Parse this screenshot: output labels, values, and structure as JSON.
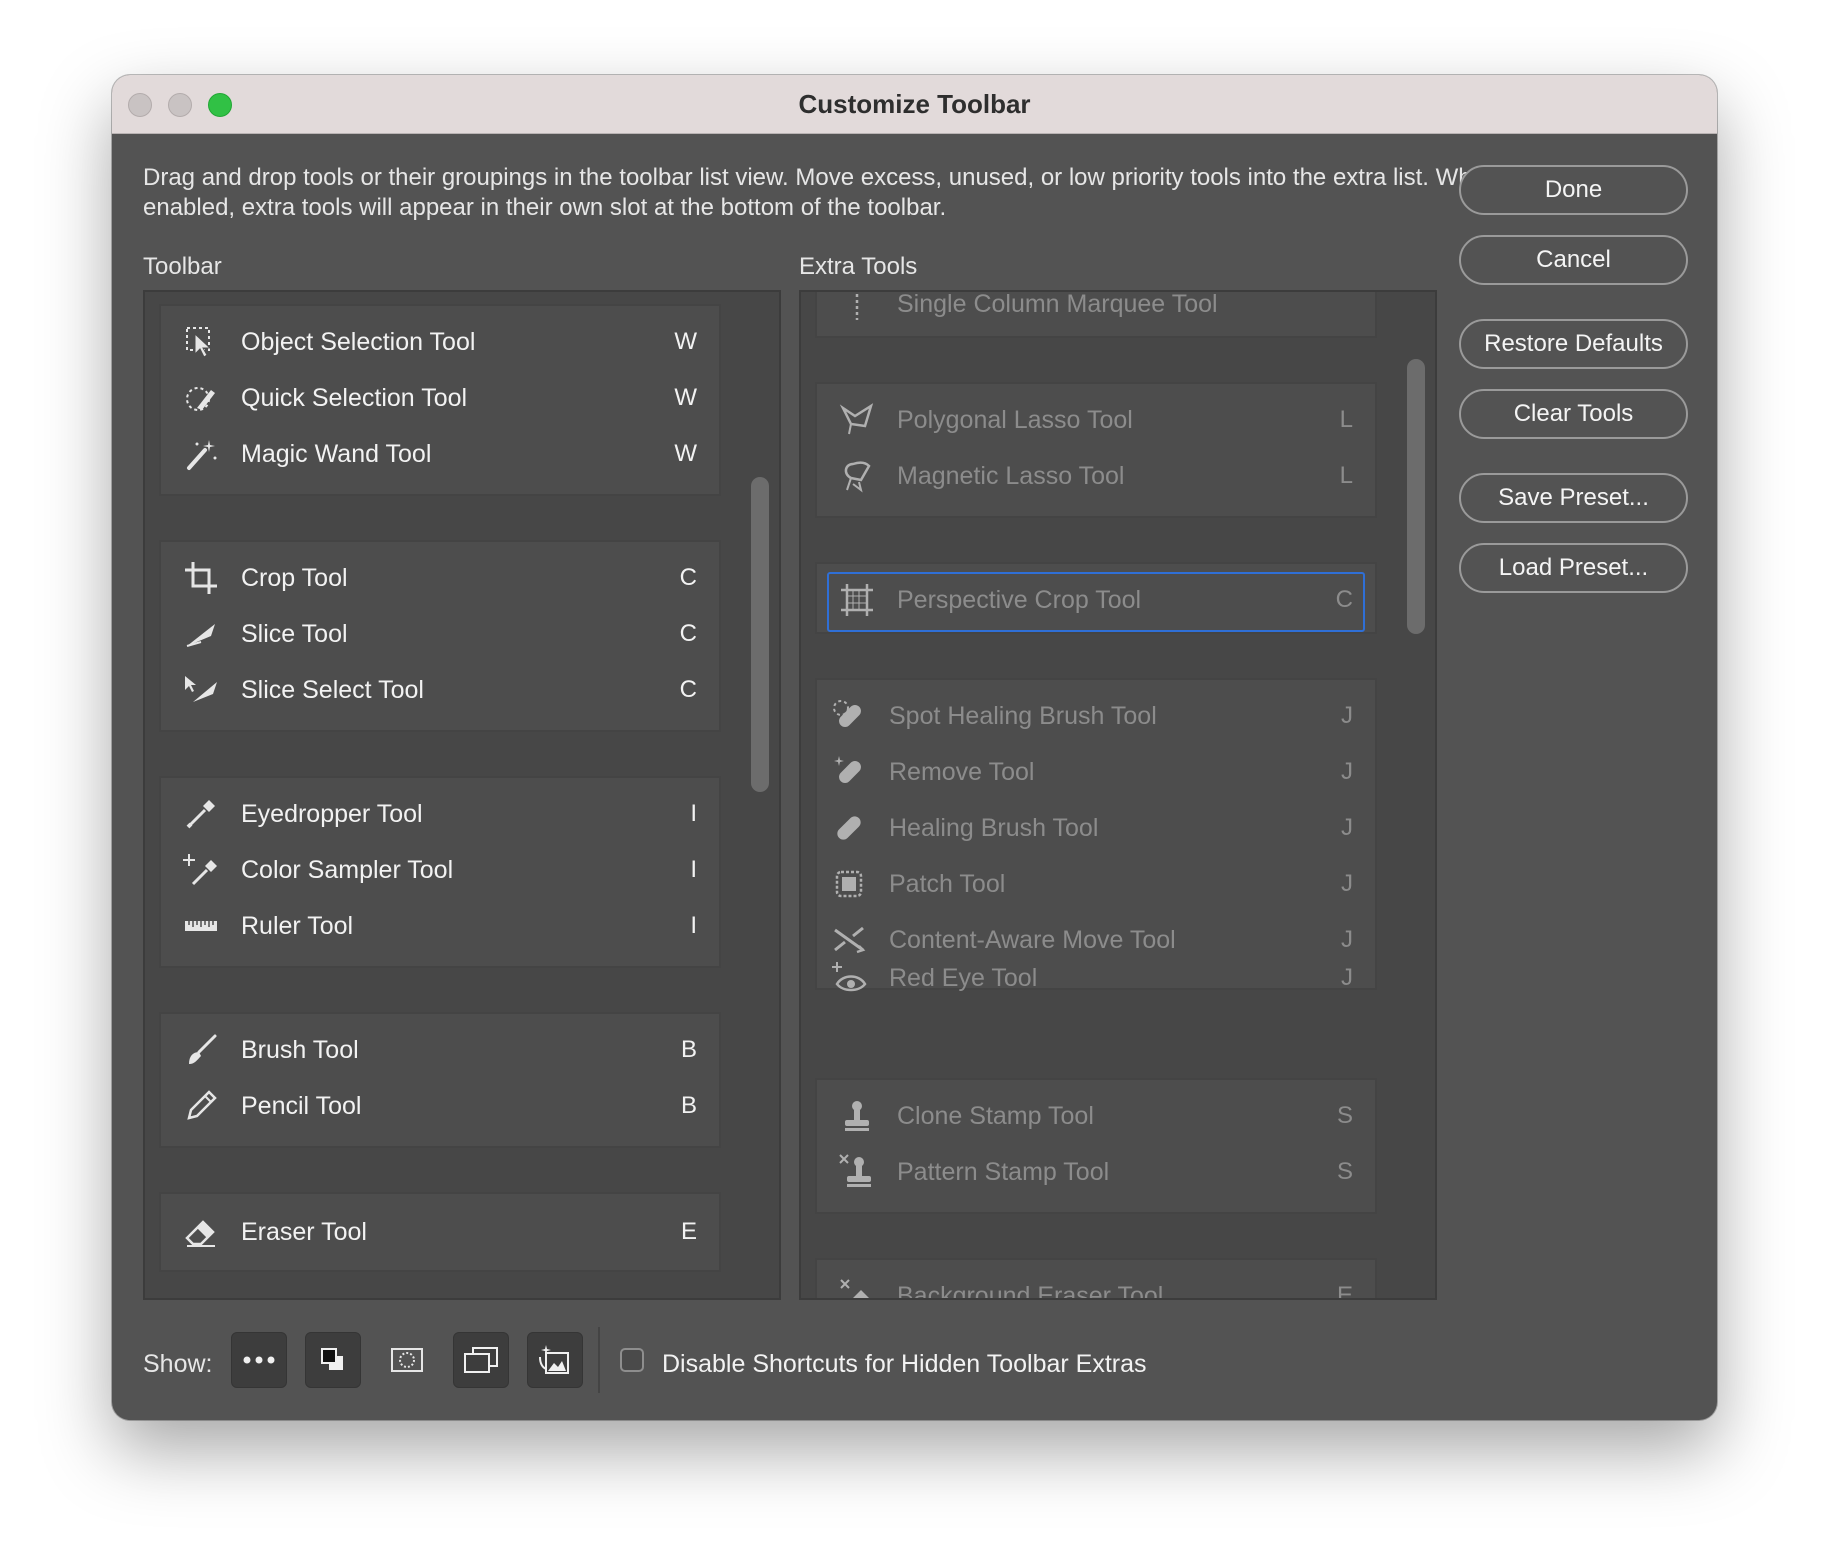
{
  "window": {
    "title": "Customize Toolbar",
    "traffic_lights": [
      "close",
      "minimize",
      "zoom"
    ]
  },
  "description": "Drag and drop tools or their groupings in the toolbar list view. Move excess, unused, or low priority tools into the extra list. When enabled, extra tools will appear in their own slot at the bottom of the toolbar.",
  "toolbar": {
    "label": "Toolbar",
    "groups": [
      [
        {
          "name": "Object Selection Tool",
          "key": "W",
          "icon": "object-selection-icon"
        },
        {
          "name": "Quick Selection Tool",
          "key": "W",
          "icon": "quick-selection-icon"
        },
        {
          "name": "Magic Wand Tool",
          "key": "W",
          "icon": "magic-wand-icon"
        }
      ],
      [
        {
          "name": "Crop Tool",
          "key": "C",
          "icon": "crop-icon"
        },
        {
          "name": "Slice Tool",
          "key": "C",
          "icon": "slice-icon"
        },
        {
          "name": "Slice Select Tool",
          "key": "C",
          "icon": "slice-select-icon"
        }
      ],
      [
        {
          "name": "Eyedropper Tool",
          "key": "I",
          "icon": "eyedropper-icon"
        },
        {
          "name": "Color Sampler Tool",
          "key": "I",
          "icon": "color-sampler-icon"
        },
        {
          "name": "Ruler Tool",
          "key": "I",
          "icon": "ruler-icon"
        }
      ],
      [
        {
          "name": "Brush Tool",
          "key": "B",
          "icon": "brush-icon"
        },
        {
          "name": "Pencil Tool",
          "key": "B",
          "icon": "pencil-icon"
        }
      ],
      [
        {
          "name": "Eraser Tool",
          "key": "E",
          "icon": "eraser-icon"
        }
      ]
    ]
  },
  "extra_tools": {
    "label": "Extra Tools",
    "groups": [
      [
        {
          "name": "Single Column Marquee Tool",
          "key": "",
          "icon": "single-column-marquee-icon"
        }
      ],
      [
        {
          "name": "Polygonal Lasso Tool",
          "key": "L",
          "icon": "polygonal-lasso-icon"
        },
        {
          "name": "Magnetic Lasso Tool",
          "key": "L",
          "icon": "magnetic-lasso-icon"
        }
      ],
      [
        {
          "name": "Perspective Crop Tool",
          "key": "C",
          "icon": "perspective-crop-icon",
          "selected": true
        }
      ],
      [
        {
          "name": "Spot Healing Brush Tool",
          "key": "J",
          "icon": "spot-healing-icon"
        },
        {
          "name": "Remove Tool",
          "key": "J",
          "icon": "remove-tool-icon"
        },
        {
          "name": "Healing Brush Tool",
          "key": "J",
          "icon": "healing-brush-icon"
        },
        {
          "name": "Patch Tool",
          "key": "J",
          "icon": "patch-icon"
        },
        {
          "name": "Content-Aware Move Tool",
          "key": "J",
          "icon": "content-aware-move-icon"
        },
        {
          "name": "Red Eye Tool",
          "key": "J",
          "icon": "red-eye-icon"
        }
      ],
      [
        {
          "name": "Clone Stamp Tool",
          "key": "S",
          "icon": "clone-stamp-icon"
        },
        {
          "name": "Pattern Stamp Tool",
          "key": "S",
          "icon": "pattern-stamp-icon"
        }
      ],
      [
        {
          "name": "Background Eraser Tool",
          "key": "E",
          "icon": "background-eraser-icon"
        }
      ]
    ]
  },
  "buttons": {
    "done": "Done",
    "cancel": "Cancel",
    "restore_defaults": "Restore Defaults",
    "clear_tools": "Clear Tools",
    "save_preset": "Save Preset...",
    "load_preset": "Load Preset..."
  },
  "footer": {
    "show_label": "Show:",
    "show_buttons": [
      "more-icon",
      "foreground-background-icon",
      "quick-mask-icon",
      "screen-mode-icon",
      "generative-icon"
    ],
    "checkbox_label": "Disable Shortcuts for Hidden Toolbar Extras",
    "checkbox_checked": false
  },
  "colors": {
    "window_bg": "#535353",
    "selection_border": "#2f6fd6",
    "zoom_light": "#31c145"
  }
}
